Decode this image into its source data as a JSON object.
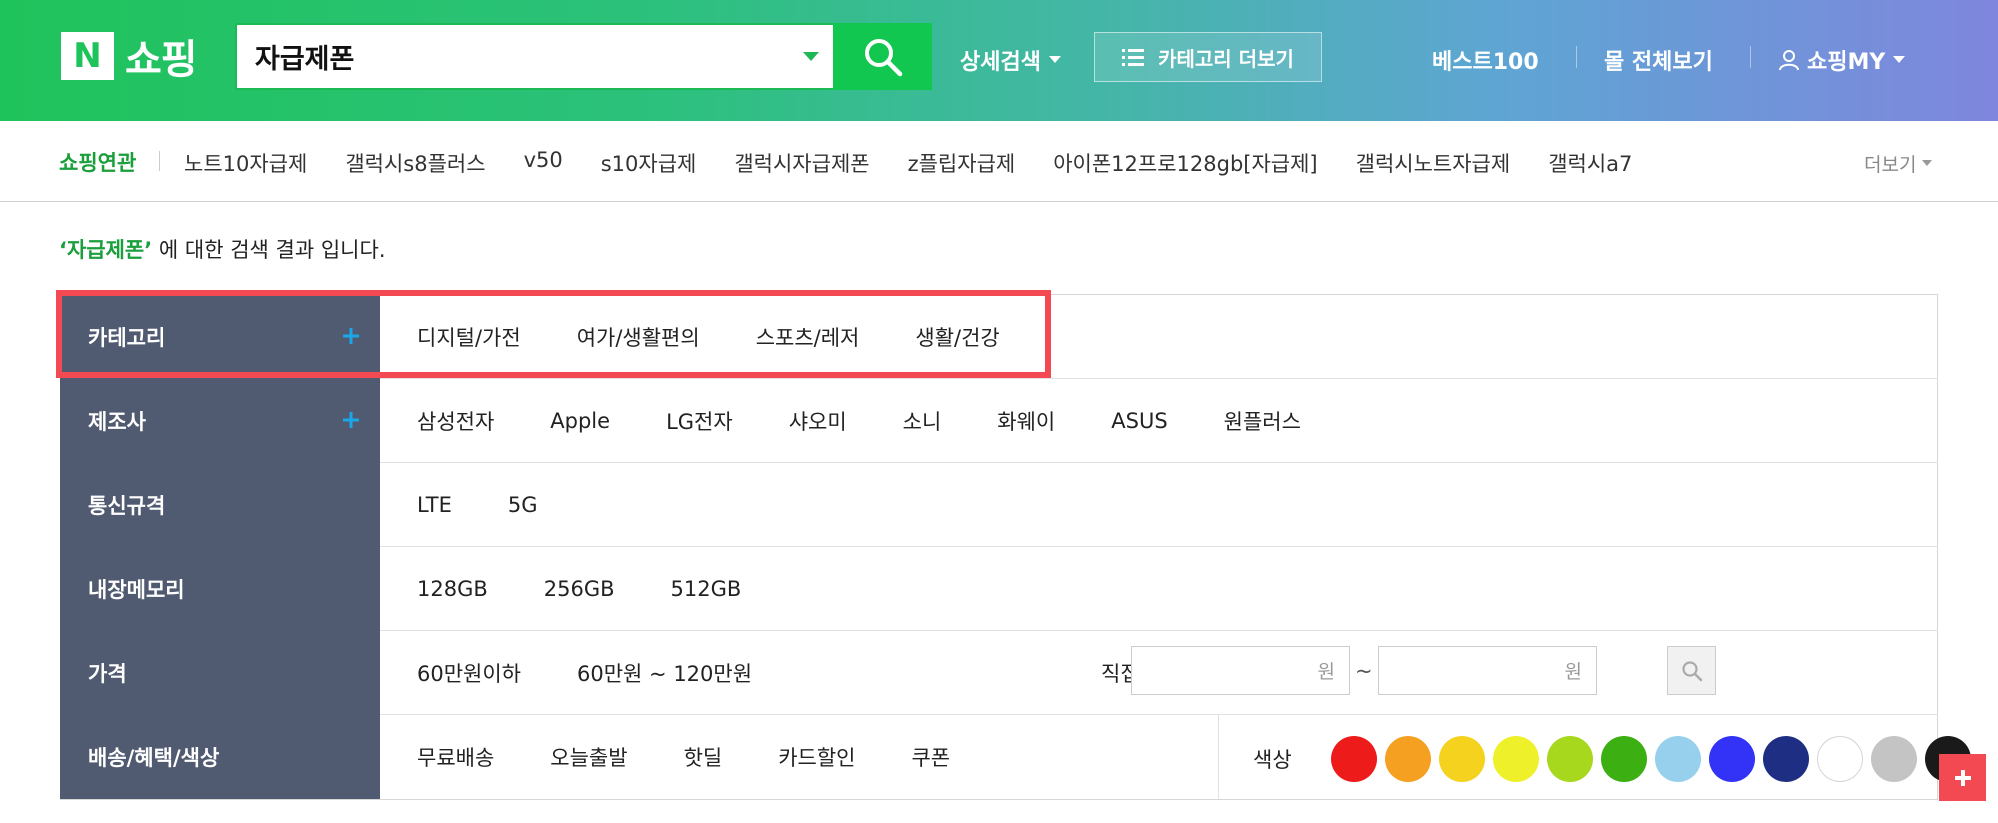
{
  "header": {
    "logo_letter": "N",
    "logo_text": "쇼핑",
    "search_value": "자급제폰",
    "advanced_search": "상세검색",
    "category_more": "카테고리 더보기",
    "best100": "베스트100",
    "all_malls": "몰 전체보기",
    "my_shopping": "쇼핑MY"
  },
  "related": {
    "title": "쇼핑연관",
    "items": [
      "노트10자급제",
      "갤럭시s8플러스",
      "v50",
      "s10자급제",
      "갤럭시자급제폰",
      "z플립자급제",
      "아이폰12프로128gb[자급제]",
      "갤럭시노트자급제",
      "갤럭시a7"
    ],
    "more": "더보기"
  },
  "result": {
    "keyword": "‘자급제폰’",
    "suffix": " 에 대한 검색 결과 입니다."
  },
  "filters": {
    "category": {
      "label": "카테고리",
      "options": [
        "디지털/가전",
        "여가/생활편의",
        "스포츠/레저",
        "생활/건강"
      ]
    },
    "maker": {
      "label": "제조사",
      "options": [
        "삼성전자",
        "Apple",
        "LG전자",
        "샤오미",
        "소니",
        "화웨이",
        "ASUS",
        "원플러스"
      ]
    },
    "network": {
      "label": "통신규격",
      "options": [
        "LTE",
        "5G"
      ]
    },
    "memory": {
      "label": "내장메모리",
      "options": [
        "128GB",
        "256GB",
        "512GB"
      ]
    },
    "price": {
      "label": "가격",
      "options": [
        "60만원이하",
        "60만원 ~ 120만원"
      ],
      "direct_input": "직접입력",
      "unit": "원",
      "tilde": "~"
    },
    "delivery": {
      "label": "배송/혜택/색상",
      "options": [
        "무료배송",
        "오늘출발",
        "핫딜",
        "카드할인",
        "쿠폰"
      ],
      "color_label": "색상",
      "colors": [
        "#ee1b1b",
        "#f5a020",
        "#f5d21e",
        "#eef12a",
        "#a7d81d",
        "#3caf13",
        "#96d0ec",
        "#3333f7",
        "#1e2e82",
        "#ffffff",
        "#c4c4c4",
        "#1a1a1a"
      ]
    }
  },
  "theme": {
    "brand_green": "#1fc35b",
    "highlight_red": "#f24952",
    "filter_label_bg": "#505a70",
    "plus_blue": "#1aa7e8"
  }
}
